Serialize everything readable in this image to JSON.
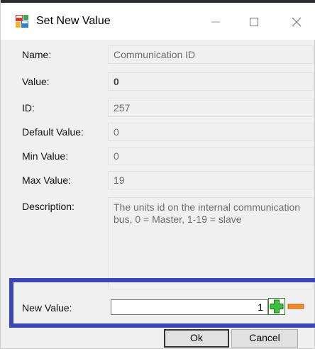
{
  "window": {
    "title": "Set New Value"
  },
  "fields": [
    {
      "label": "Name:",
      "value": "Communication ID"
    },
    {
      "label": "Value:",
      "value": "0"
    },
    {
      "label": "ID:",
      "value": "257"
    },
    {
      "label": "Default Value:",
      "value": "0"
    },
    {
      "label": "Min Value:",
      "value": "0"
    },
    {
      "label": "Max Value:",
      "value": "19"
    }
  ],
  "description": {
    "label": "Description:",
    "value": "The units id on the internal communication bus, 0 = Master, 1-19 = slave"
  },
  "new_value": {
    "label": "New Value:",
    "value": "1"
  },
  "buttons": {
    "ok": "Ok",
    "cancel": "Cancel"
  },
  "colors": {
    "highlight": "#3b48b4",
    "plus": "#2ca02c",
    "minus": "#f08a24"
  },
  "icons": [
    "app-icon",
    "minimize-icon",
    "maximize-icon",
    "close-icon",
    "plus-icon",
    "minus-icon"
  ]
}
